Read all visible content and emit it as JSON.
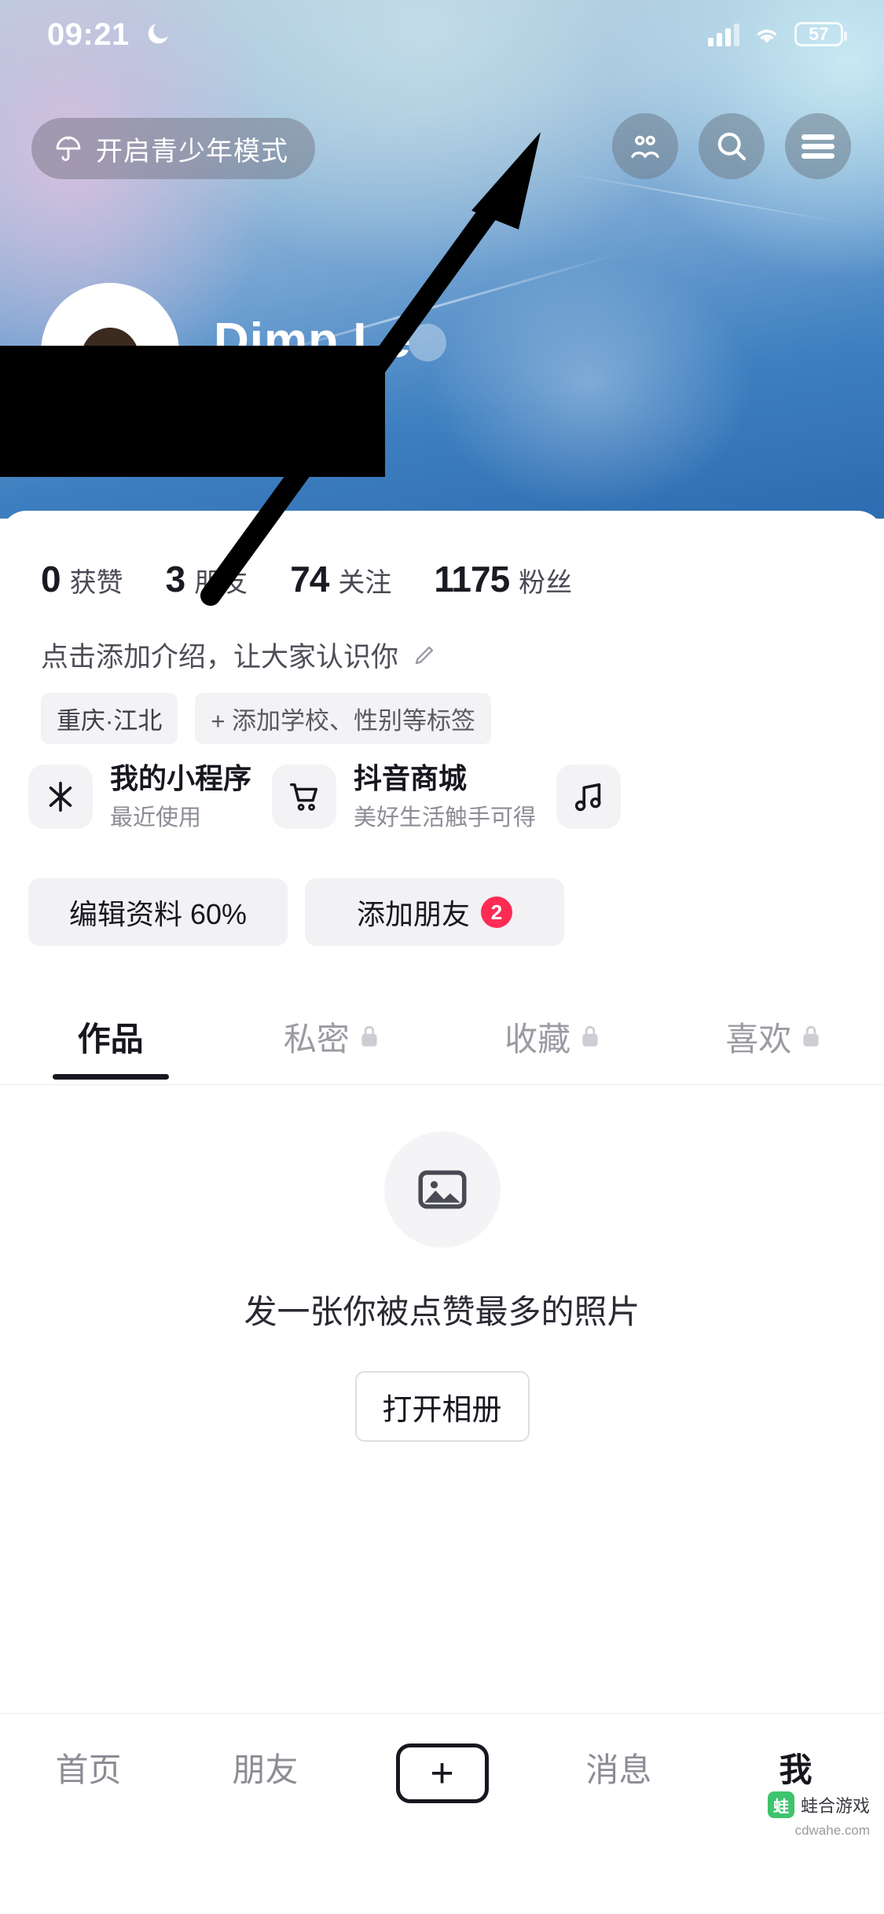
{
  "status_bar": {
    "time": "09:21",
    "moon_icon": "crescent-moon-icon",
    "signal_icon": "cellular-signal-icon",
    "wifi_icon": "wifi-icon",
    "battery_level": "57"
  },
  "header": {
    "teen_mode_label": "开启青少年模式",
    "teen_mode_icon": "umbrella-icon",
    "actions": [
      {
        "name": "friends-icon",
        "label": ""
      },
      {
        "name": "search-icon",
        "label": ""
      },
      {
        "name": "menu-icon",
        "label": ""
      }
    ]
  },
  "profile": {
    "username": "Dimp Le",
    "avatar_icon": "user-avatar",
    "verified_icon": "verified-badge"
  },
  "stats": [
    {
      "num": "0",
      "label": "获赞"
    },
    {
      "num": "3",
      "label": "朋友"
    },
    {
      "num": "74",
      "label": "关注"
    },
    {
      "num": "1175",
      "label": "粉丝"
    }
  ],
  "bio": {
    "placeholder": "点击添加介绍，让大家认识你",
    "edit_icon": "pencil-icon"
  },
  "tags": [
    {
      "text": "重庆·江北",
      "icon": ""
    },
    {
      "text": "+ 添加学校、性别等标签",
      "icon": "plus-icon"
    }
  ],
  "services": [
    {
      "icon": "mini-program-icon",
      "title": "我的小程序",
      "subtitle": "最近使用"
    },
    {
      "icon": "shopping-cart-icon",
      "title": "抖音商城",
      "subtitle": "美好生活触手可得"
    },
    {
      "icon": "music-note-icon",
      "title": "",
      "subtitle": ""
    }
  ],
  "actions": {
    "edit_profile": "编辑资料 60%",
    "add_friend": "添加朋友",
    "add_friend_badge": "2"
  },
  "tabs": [
    {
      "label": "作品",
      "locked": false,
      "active": true
    },
    {
      "label": "私密",
      "locked": true,
      "active": false
    },
    {
      "label": "收藏",
      "locked": true,
      "active": false
    },
    {
      "label": "喜欢",
      "locked": true,
      "active": false
    }
  ],
  "empty_state": {
    "icon": "image-placeholder-icon",
    "message": "发一张你被点赞最多的照片",
    "button": "打开相册"
  },
  "bottom_nav": [
    {
      "label": "首页",
      "active": false
    },
    {
      "label": "朋友",
      "active": false
    },
    {
      "label": "+",
      "active": false
    },
    {
      "label": "消息",
      "active": false
    },
    {
      "label": "我",
      "active": true
    }
  ],
  "watermark": {
    "brand": "蛙合游戏",
    "url": "cdwahe.com"
  },
  "colors": {
    "accent_red": "#fe2c55",
    "text_primary": "#17171f",
    "text_secondary": "#8d8d96",
    "chip_bg": "#f3f3f5"
  }
}
